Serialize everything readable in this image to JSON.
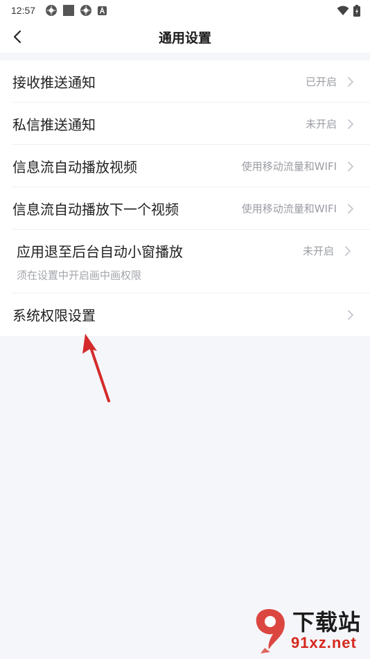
{
  "status_bar": {
    "time": "12:57"
  },
  "header": {
    "title": "通用设置"
  },
  "settings": [
    {
      "label": "接收推送通知",
      "value": "已开启"
    },
    {
      "label": "私信推送通知",
      "value": "未开启"
    },
    {
      "label": "信息流自动播放视频",
      "value": "使用移动流量和WIFI"
    },
    {
      "label": "信息流自动播放下一个视频",
      "value": "使用移动流量和WIFI"
    }
  ],
  "pip_setting": {
    "label": "应用退至后台自动小窗播放",
    "value": "未开启",
    "hint": "须在设置中开启画中画权限"
  },
  "permissions_setting": {
    "label": "系统权限设置"
  },
  "watermark": {
    "title": "下载站",
    "url": "91xz.net"
  },
  "colors": {
    "background": "#f5f6fa",
    "arrow": "#d42a2a",
    "watermark_red": "#d6281e"
  }
}
